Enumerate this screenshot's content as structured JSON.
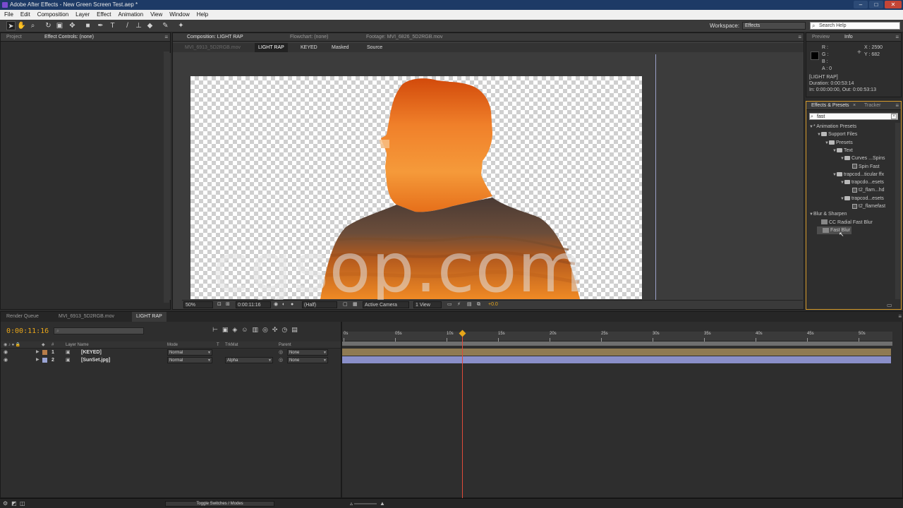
{
  "window": {
    "title": "Adobe After Effects - New Green Screen Test.aep *",
    "buttons": [
      "–",
      "□",
      "✕"
    ]
  },
  "menu": [
    "File",
    "Edit",
    "Composition",
    "Layer",
    "Effect",
    "Animation",
    "View",
    "Window",
    "Help"
  ],
  "toolbar": {
    "workspace_label": "Workspace:",
    "workspace_value": "Effects",
    "search_placeholder": "Search Help"
  },
  "left_panel": {
    "tabs": [
      "Project",
      "Effect Controls: (none)"
    ]
  },
  "comp_viewer": {
    "tabs": [
      "Composition: LIGHT RAP",
      "Flowchart: (none)",
      "Footage: MVI_6826_5D2RGB.mov"
    ],
    "flow_tabs": [
      "MVI_6913_5D2RGB.mov",
      "LIGHT RAP",
      "KEYED",
      "Masked",
      "Source"
    ],
    "viewbar": {
      "zoom": "50%",
      "timecode": "0:00:11:16",
      "resolution": "(Half)",
      "camera": "Active Camera",
      "views": "1 View",
      "exposure": "+0.0"
    }
  },
  "info_panel": {
    "tabs": [
      "Preview",
      "Info"
    ],
    "r": "R :",
    "g": "G :",
    "b": "B :",
    "a": "A : 0",
    "x": "X : 2590",
    "y": "Y : 682",
    "comp_name": "[LIGHT RAP]",
    "duration": "Duration: 0:00:53:14",
    "in_out": "In: 0:00:00:00, Out: 0:00:53:13"
  },
  "effects_panel": {
    "tabs": [
      "Effects & Presets",
      "Tracker"
    ],
    "search_value": "fast",
    "tree": [
      {
        "label": "* Animation Presets",
        "indent": 0,
        "tri": "▼",
        "kind": "none"
      },
      {
        "label": "Support Files",
        "indent": 1,
        "tri": "▼",
        "kind": "folder"
      },
      {
        "label": "Presets",
        "indent": 2,
        "tri": "▼",
        "kind": "folder"
      },
      {
        "label": "Text",
        "indent": 3,
        "tri": "▼",
        "kind": "folder"
      },
      {
        "label": "Curves ...Spins",
        "indent": 4,
        "tri": "▼",
        "kind": "folder"
      },
      {
        "label": "Spin Fast",
        "indent": 5,
        "tri": "",
        "kind": "preset"
      },
      {
        "label": "trapcod...ticular ffx",
        "indent": 3,
        "tri": "▼",
        "kind": "folder"
      },
      {
        "label": "trapcdo...esets",
        "indent": 4,
        "tri": "▼",
        "kind": "folder"
      },
      {
        "label": "t2_flam...hd",
        "indent": 5,
        "tri": "",
        "kind": "preset"
      },
      {
        "label": "trapcod...esets",
        "indent": 4,
        "tri": "▼",
        "kind": "folder"
      },
      {
        "label": "t2_flamefast",
        "indent": 5,
        "tri": "",
        "kind": "preset"
      },
      {
        "label": "Blur & Sharpen",
        "indent": 0,
        "tri": "▼",
        "kind": "none"
      },
      {
        "label": "CC Radial Fast Blur",
        "indent": 1,
        "tri": "",
        "kind": "fx"
      },
      {
        "label": "Fast Blur",
        "indent": 1,
        "tri": "",
        "kind": "fx"
      }
    ]
  },
  "timeline": {
    "tabs": [
      "Render Queue",
      "MVI_6913_5D2RGB.mov",
      "LIGHT RAP"
    ],
    "timecode": "0:00:11:16",
    "search_placeholder": "",
    "columns": [
      "#",
      "Layer Name",
      "Mode",
      "T",
      "TrkMat",
      "Parent"
    ],
    "layers": [
      {
        "num": "1",
        "name": "[KEYED]",
        "mode": "Normal",
        "trkmat": "",
        "parent": "None",
        "color": "#b77d4a"
      },
      {
        "num": "2",
        "name": "[SunSet.jpg]",
        "mode": "Normal",
        "trkmat": "Alpha",
        "parent": "None",
        "color": "#9aa4d4"
      }
    ],
    "ruler": [
      "0s",
      "05s",
      "10s",
      "15s",
      "20s",
      "25s",
      "30s",
      "35s",
      "40s",
      "45s",
      "50s"
    ],
    "playhead_fraction": 0.2181,
    "toggle_label": "Toggle Switches / Modes"
  },
  "watermark": "cgsop.com",
  "colors": {
    "accent": "#e8a61a",
    "playhead": "#e04a3a",
    "layer1_bar": "#8f7a53",
    "layer2_bar": "#8a8fc9",
    "effects_border": "#d69b2a"
  }
}
